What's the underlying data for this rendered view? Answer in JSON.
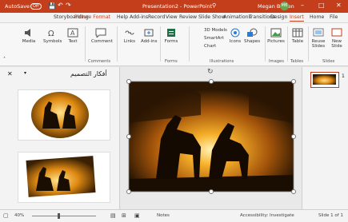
{
  "titlebar": {
    "autosave": "AutoSave",
    "autosave_state": "Off",
    "title": "Presentation2 - PowerPoint",
    "user": "Megan Bowen",
    "user_initials": "MB"
  },
  "tabs": [
    "File",
    "Home",
    "Insert",
    "Design",
    "Transitions",
    "Animations",
    "Slide Show",
    "Review",
    "View",
    "Record",
    "Add-ins",
    "Help",
    "Storyboarding",
    "Picture Format"
  ],
  "ribbon": {
    "buttons": {
      "new_slide": "New Slide",
      "reuse_slides": "Reuse Slides",
      "table": "Table",
      "pictures": "Pictures",
      "shapes": "Shapes",
      "icons": "Icons",
      "models_3d": "3D Models",
      "smartart": "SmartArt",
      "chart": "Chart",
      "forms": "Forms",
      "addins": "Add-ins",
      "links": "Links",
      "comment": "Comment",
      "text": "Text",
      "symbols": "Symbols",
      "media": "Media"
    },
    "groups": {
      "slides": "Slides",
      "tables": "Tables",
      "images": "Images",
      "illustrations": "Illustrations",
      "forms": "Forms",
      "comments": "Comments"
    }
  },
  "designer": {
    "title": "أفكار التصميم"
  },
  "thumbs": {
    "slide_number": "1"
  },
  "status": {
    "slide": "Slide 1 of 1",
    "accessibility": "Accessibility: Investigate",
    "notes": "Notes",
    "zoom": "40%"
  },
  "colors": {
    "brand": "#c43e1c",
    "accent": "#2b7cd3"
  }
}
